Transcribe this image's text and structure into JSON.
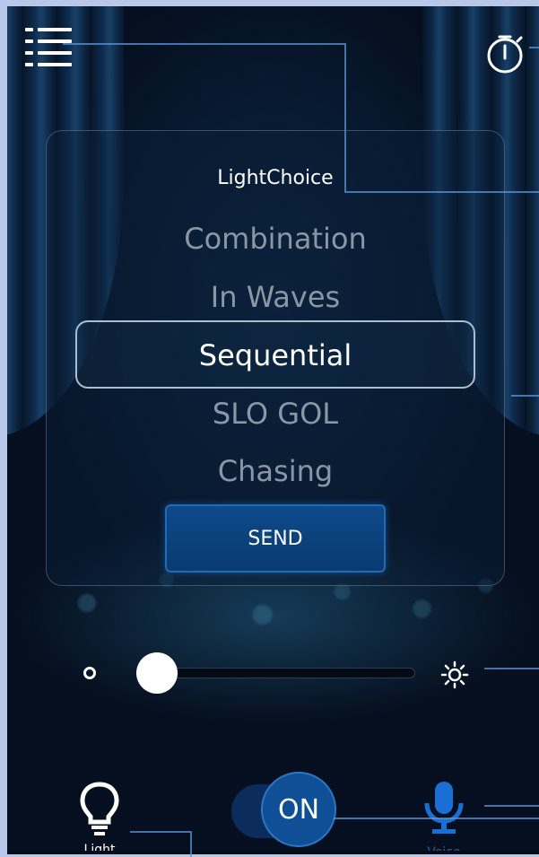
{
  "app": {
    "title": "LightChoice"
  },
  "options": [
    {
      "label": "Combination",
      "selected": false
    },
    {
      "label": "In Waves",
      "selected": false
    },
    {
      "label": "Sequential",
      "selected": true
    },
    {
      "label": "SLO GOL",
      "selected": false
    },
    {
      "label": "Chasing",
      "selected": false
    }
  ],
  "send_button": {
    "label": "SEND"
  },
  "brightness": {
    "level": 0.07
  },
  "power_toggle": {
    "label": "ON",
    "state": "on"
  },
  "bottom_nav": {
    "light_label": "Light",
    "voice_label": "Voice"
  },
  "icons": {
    "menu": "menu-list-icon",
    "timer": "stopwatch-icon",
    "brightness_low": "brightness-low-icon",
    "brightness_high": "brightness-high-icon",
    "bulb": "light-bulb-icon",
    "mic": "microphone-icon"
  },
  "colors": {
    "accent": "#0f4f96",
    "mic": "#1a6fd6",
    "callout": "#5a93d8"
  }
}
